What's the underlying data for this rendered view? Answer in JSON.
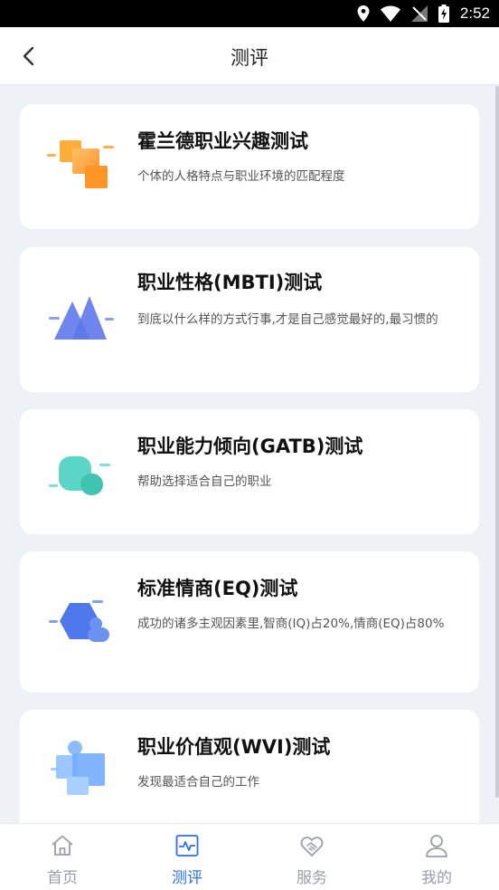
{
  "status": {
    "time": "2:52"
  },
  "header": {
    "title": "测评"
  },
  "cards": [
    {
      "title": "霍兰德职业兴趣测试",
      "desc": "个体的人格特点与职业环境的匹配程度",
      "icon": "orange-squares-icon"
    },
    {
      "title": "职业性格(MBTI)测试",
      "desc": "到底以什么样的方式行事,才是自己感觉最好的,最习惯的",
      "icon": "blue-mountains-icon"
    },
    {
      "title": "职业能力倾向(GATB)测试",
      "desc": "帮助选择适合自己的职业",
      "icon": "teal-blobs-icon"
    },
    {
      "title": "标准情商(EQ)测试",
      "desc": "成功的诸多主观因素里,智商(IQ)占20%,情商(EQ)占80%",
      "icon": "blue-hexagon-icon"
    },
    {
      "title": "职业价值观(WVI)测试",
      "desc": "发现最适合自己的工作",
      "icon": "lightblue-blocks-icon"
    }
  ],
  "tabs": [
    {
      "label": "首页",
      "icon": "home-icon"
    },
    {
      "label": "测评",
      "icon": "assessment-icon",
      "active": true
    },
    {
      "label": "服务",
      "icon": "handshake-icon"
    },
    {
      "label": "我的",
      "icon": "profile-icon"
    }
  ],
  "colors": {
    "accent": "#2a6ff0",
    "background": "#eef1f6"
  }
}
